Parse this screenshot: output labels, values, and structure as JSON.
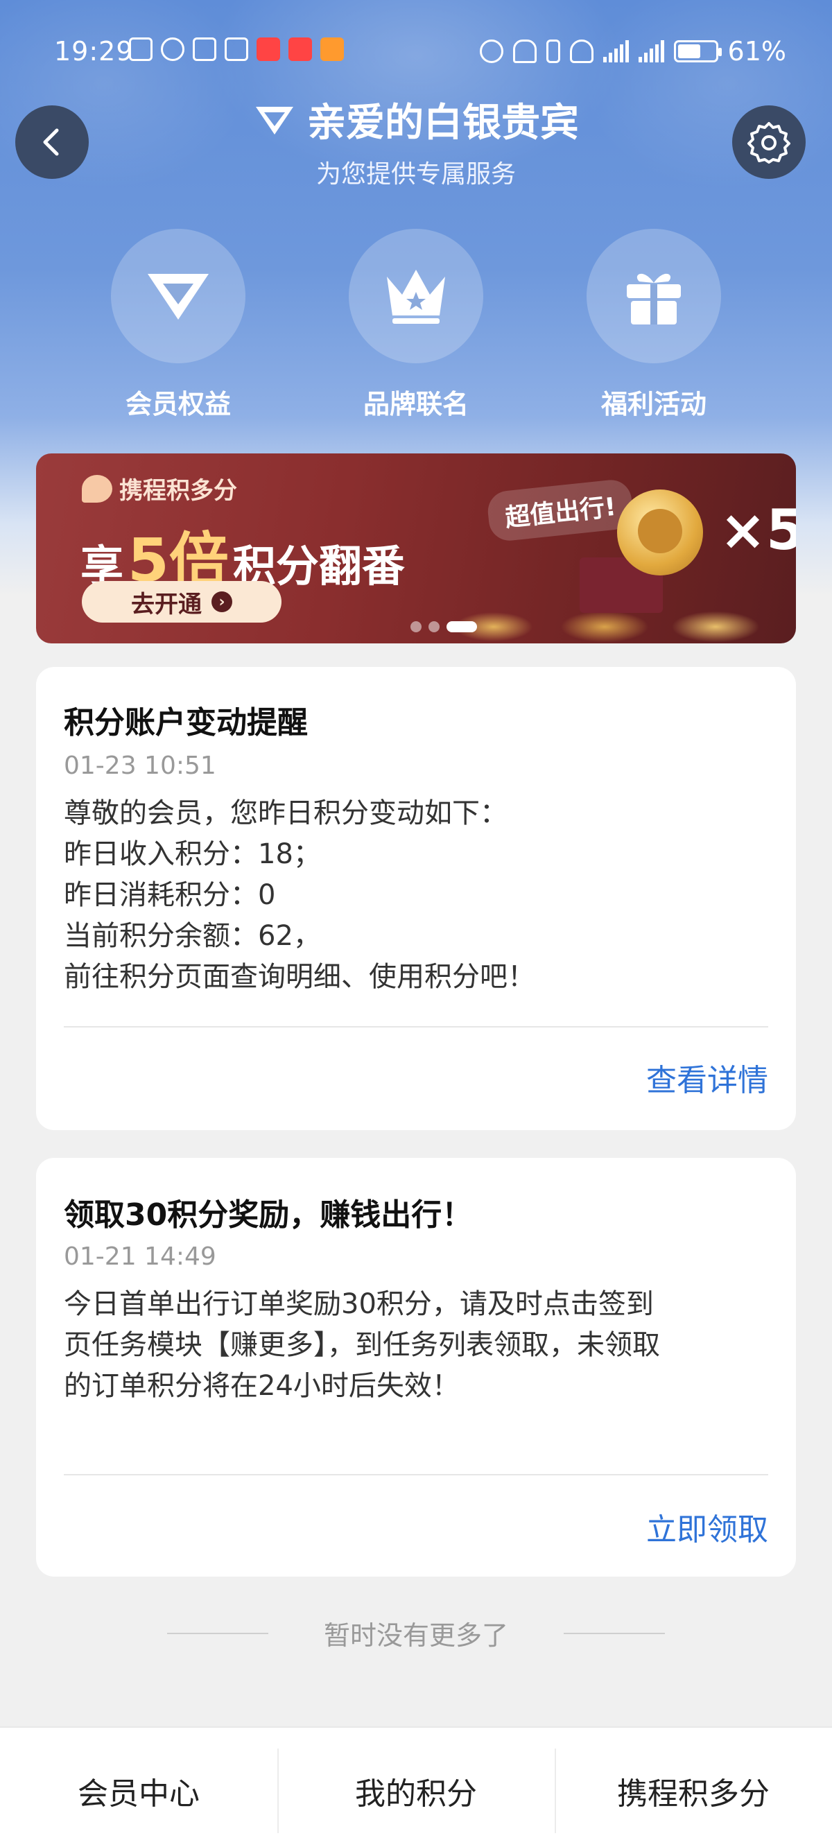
{
  "status_bar": {
    "time": "19:29",
    "battery_pct": "61%",
    "battery_level": 0.61
  },
  "header": {
    "title": "亲爱的白银贵宾",
    "subtitle": "为您提供专属服务"
  },
  "entries": [
    {
      "label": "会员权益",
      "icon": "diamond-icon"
    },
    {
      "label": "品牌联名",
      "icon": "crown-icon"
    },
    {
      "label": "福利活动",
      "icon": "gift-icon"
    }
  ],
  "banner": {
    "brand": "携程积多分",
    "slogan_prefix": "享",
    "slogan_number": "5倍",
    "slogan_suffix": "积分翻番",
    "cta": "去开通",
    "tag": "超值出行!",
    "multiplier": "×5",
    "slide_count": 3,
    "active_slide": 3
  },
  "messages": [
    {
      "title": "积分账户变动提醒",
      "time": "01-23 10:51",
      "body": [
        "尊敬的会员，您昨日积分变动如下：",
        "昨日收入积分：18；",
        "昨日消耗积分：0",
        "当前积分余额：62，",
        "前往积分页面查询明细、使用积分吧！"
      ],
      "action": "查看详情"
    },
    {
      "title": "领取30积分奖励，赚钱出行！",
      "time": "01-21 14:49",
      "body": [
        "今日首单出行订单奖励30积分，请及时点击签到",
        "页任务模块【赚更多】，到任务列表领取，未领取",
        "的订单积分将在24小时后失效！"
      ],
      "action": "立即领取"
    }
  ],
  "no_more_text": "暂时没有更多了",
  "bottom_tabs": [
    "会员中心",
    "我的积分",
    "携程积多分"
  ],
  "colors": {
    "accent_blue": "#2f73d8",
    "header_bg": "#5f8dd8",
    "banner_bg": "#8a2e2e"
  }
}
